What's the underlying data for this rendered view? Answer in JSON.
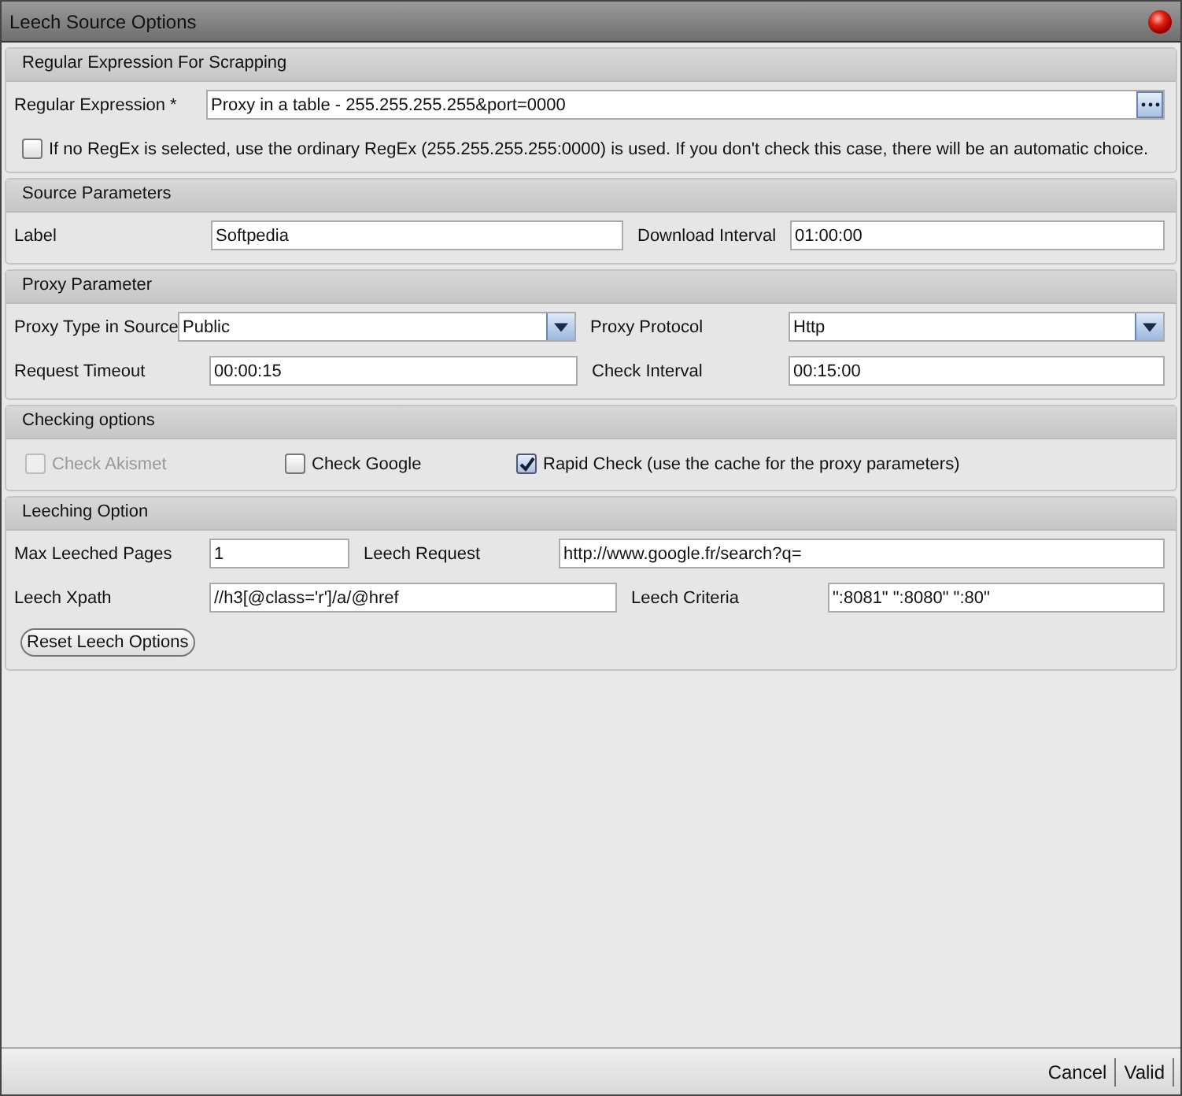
{
  "window": {
    "title": "Leech Source Options"
  },
  "sections": [
    {
      "title": "Regular Expression For Scrapping",
      "rows": [
        {
          "pairs": [
            {
              "label": "Regular Expression *",
              "kind": "browse",
              "value": "Proxy in a table - 255.255.255.255&port=0000"
            }
          ]
        }
      ],
      "checkboxes": [
        {
          "label": "If no RegEx is selected, use the ordinary RegEx (255.255.255.255:0000) is used. If you don't check this case, there will be an automatic choice.",
          "checked": false,
          "disabled": false
        }
      ]
    },
    {
      "title": "Source Parameters",
      "rows": [
        {
          "pairs": [
            {
              "label": "Label",
              "kind": "field",
              "value": "Softpedia"
            },
            {
              "label": "Download Interval",
              "kind": "field",
              "value": "01:00:00"
            }
          ]
        }
      ]
    },
    {
      "title": "Proxy Parameter",
      "rows": [
        {
          "pairs": [
            {
              "label": "Proxy Type in Source",
              "kind": "select",
              "value": "Public"
            },
            {
              "label": "Proxy Protocol",
              "kind": "select",
              "value": "Http"
            }
          ]
        },
        {
          "pairs": [
            {
              "label": "Request Timeout",
              "kind": "field",
              "value": "00:00:15"
            },
            {
              "label": "Check Interval",
              "kind": "field",
              "value": "00:15:00"
            }
          ]
        }
      ]
    },
    {
      "title": "Checking options",
      "checkboxes": [
        {
          "label": "Check Akismet",
          "checked": false,
          "disabled": true
        },
        {
          "label": "Check Google",
          "checked": false,
          "disabled": false
        },
        {
          "label": "Rapid Check (use the cache for the proxy parameters)",
          "checked": true,
          "disabled": false
        }
      ]
    },
    {
      "title": "Leeching Option",
      "rows": [
        {
          "pairs": [
            {
              "label": "Max Leeched Pages",
              "kind": "field",
              "value": "1"
            },
            {
              "label": "Leech Request",
              "kind": "field",
              "value": "http://www.google.fr/search?q="
            }
          ]
        },
        {
          "pairs": [
            {
              "label": "Leech Xpath",
              "kind": "field",
              "value": "//h3[@class='r']/a/@href"
            },
            {
              "label": "Leech Criteria",
              "kind": "field",
              "value": "\":8081\" \":8080\" \":80\""
            }
          ]
        }
      ],
      "buttons": [
        "Reset Leech Options"
      ]
    }
  ],
  "footer_buttons": [
    "Cancel",
    "Valid"
  ]
}
